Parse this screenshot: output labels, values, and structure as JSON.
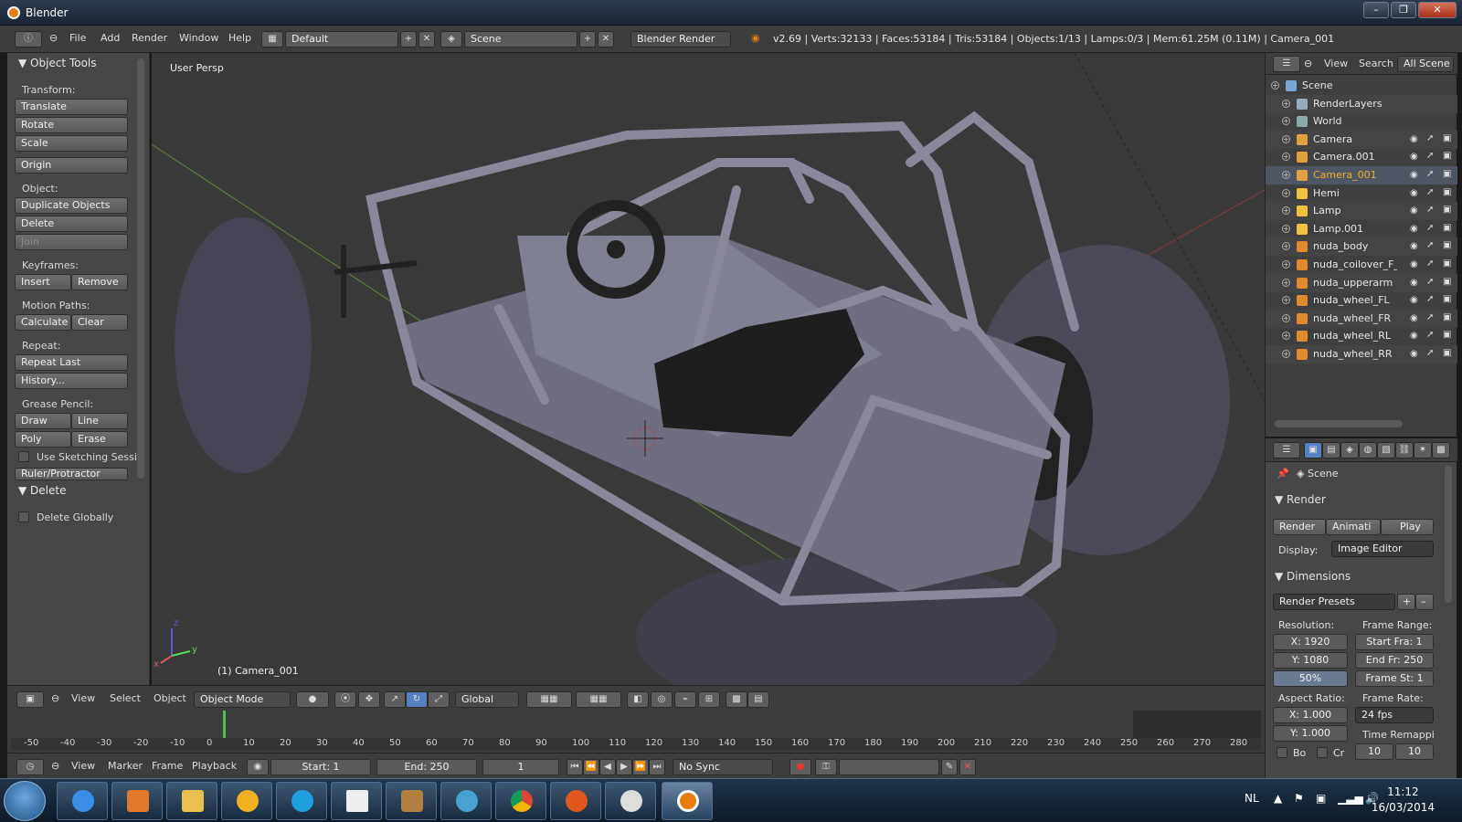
{
  "window": {
    "title": "Blender",
    "minimize": "–",
    "maximize": "❐",
    "close": "✕"
  },
  "info_header": {
    "menus": [
      "File",
      "Add",
      "Render",
      "Window",
      "Help"
    ],
    "screen_layout": "Default",
    "scene": "Scene",
    "render_engine": "Blender Render",
    "stats": "v2.69 | Verts:32133 | Faces:53184 | Tris:53184 | Objects:1/13 | Lamps:0/3 | Mem:61.25M (0.11M) | Camera_001"
  },
  "tool_panel": {
    "header": "Object Tools",
    "transform_label": "Transform:",
    "translate": "Translate",
    "rotate": "Rotate",
    "scale": "Scale",
    "origin": "Origin",
    "object_label": "Object:",
    "duplicate": "Duplicate Objects",
    "delete": "Delete",
    "join": "Join",
    "keyframes_label": "Keyframes:",
    "insert": "Insert",
    "remove": "Remove",
    "motion_paths_label": "Motion Paths:",
    "calculate": "Calculate",
    "clear": "Clear",
    "repeat_label": "Repeat:",
    "repeat_last": "Repeat Last",
    "history": "History...",
    "grease_label": "Grease Pencil:",
    "draw": "Draw",
    "line": "Line",
    "poly": "Poly",
    "erase": "Erase",
    "use_sketching": "Use Sketching Sessi",
    "ruler": "Ruler/Protractor",
    "delete_header": "Delete",
    "delete_globally": "Delete Globally"
  },
  "viewport": {
    "view_label": "User Persp",
    "active_object": "(1) Camera_001",
    "axis_x": "x",
    "axis_y": "y",
    "axis_z": "z"
  },
  "view3d_header": {
    "view": "View",
    "select": "Select",
    "object": "Object",
    "mode": "Object Mode",
    "orientation": "Global"
  },
  "timeline": {
    "ticks": [
      "-50",
      "-40",
      "-30",
      "-20",
      "-10",
      "0",
      "10",
      "20",
      "30",
      "40",
      "50",
      "60",
      "70",
      "80",
      "90",
      "100",
      "110",
      "120",
      "130",
      "140",
      "150",
      "160",
      "170",
      "180",
      "190",
      "200",
      "210",
      "220",
      "230",
      "240",
      "250",
      "260",
      "270",
      "280"
    ],
    "view": "View",
    "marker": "Marker",
    "frame": "Frame",
    "playback": "Playback",
    "start": "Start: 1",
    "end": "End: 250",
    "current": "1",
    "sync": "No Sync"
  },
  "outliner": {
    "view": "View",
    "search": "Search",
    "filter": "All Scene",
    "items": [
      {
        "name": "Scene",
        "type": "scene",
        "color": "#7aa6d6"
      },
      {
        "name": "RenderLayers",
        "type": "layers",
        "color": "#9ab"
      },
      {
        "name": "World",
        "type": "world",
        "color": "#8aa"
      },
      {
        "name": "Camera",
        "type": "camera",
        "color": "#e0a040"
      },
      {
        "name": "Camera.001",
        "type": "camera",
        "color": "#e0a040"
      },
      {
        "name": "Camera_001",
        "type": "camera",
        "color": "#e0a040",
        "selected": true
      },
      {
        "name": "Hemi",
        "type": "lamp",
        "color": "#f0c040"
      },
      {
        "name": "Lamp",
        "type": "lamp",
        "color": "#f0c040"
      },
      {
        "name": "Lamp.001",
        "type": "lamp",
        "color": "#f0c040"
      },
      {
        "name": "nuda_body",
        "type": "mesh",
        "color": "#e08a30"
      },
      {
        "name": "nuda_coilover_F_off",
        "type": "mesh",
        "color": "#e08a30"
      },
      {
        "name": "nuda_upperarm",
        "type": "mesh",
        "color": "#e08a30"
      },
      {
        "name": "nuda_wheel_FL",
        "type": "mesh",
        "color": "#e08a30"
      },
      {
        "name": "nuda_wheel_FR",
        "type": "mesh",
        "color": "#e08a30"
      },
      {
        "name": "nuda_wheel_RL",
        "type": "mesh",
        "color": "#e08a30"
      },
      {
        "name": "nuda_wheel_RR",
        "type": "mesh",
        "color": "#e08a30"
      }
    ]
  },
  "properties": {
    "scene": "Scene",
    "render_header": "Render",
    "render_btn": "Render",
    "animation_btn": "Animati",
    "play_btn": "Play",
    "display_label": "Display:",
    "display_value": "Image Editor",
    "dimensions_header": "Dimensions",
    "presets": "Render Presets",
    "resolution_label": "Resolution:",
    "res_x": "X: 1920",
    "res_y": "Y: 1080",
    "res_pct": "50%",
    "frame_range_label": "Frame Range:",
    "start_frame": "Start Fra: 1",
    "end_frame": "End Fr: 250",
    "frame_step": "Frame St: 1",
    "aspect_label": "Aspect Ratio:",
    "aspect_x": "X: 1.000",
    "aspect_y": "Y: 1.000",
    "frame_rate_label": "Frame Rate:",
    "fps": "24 fps",
    "time_remap": "Time Remappi",
    "border": "Bo",
    "crop": "Cr",
    "remap_old": "10",
    "remap_new": "10"
  },
  "taskbar": {
    "language": "NL",
    "time": "11:12",
    "date": "16/03/2014"
  }
}
